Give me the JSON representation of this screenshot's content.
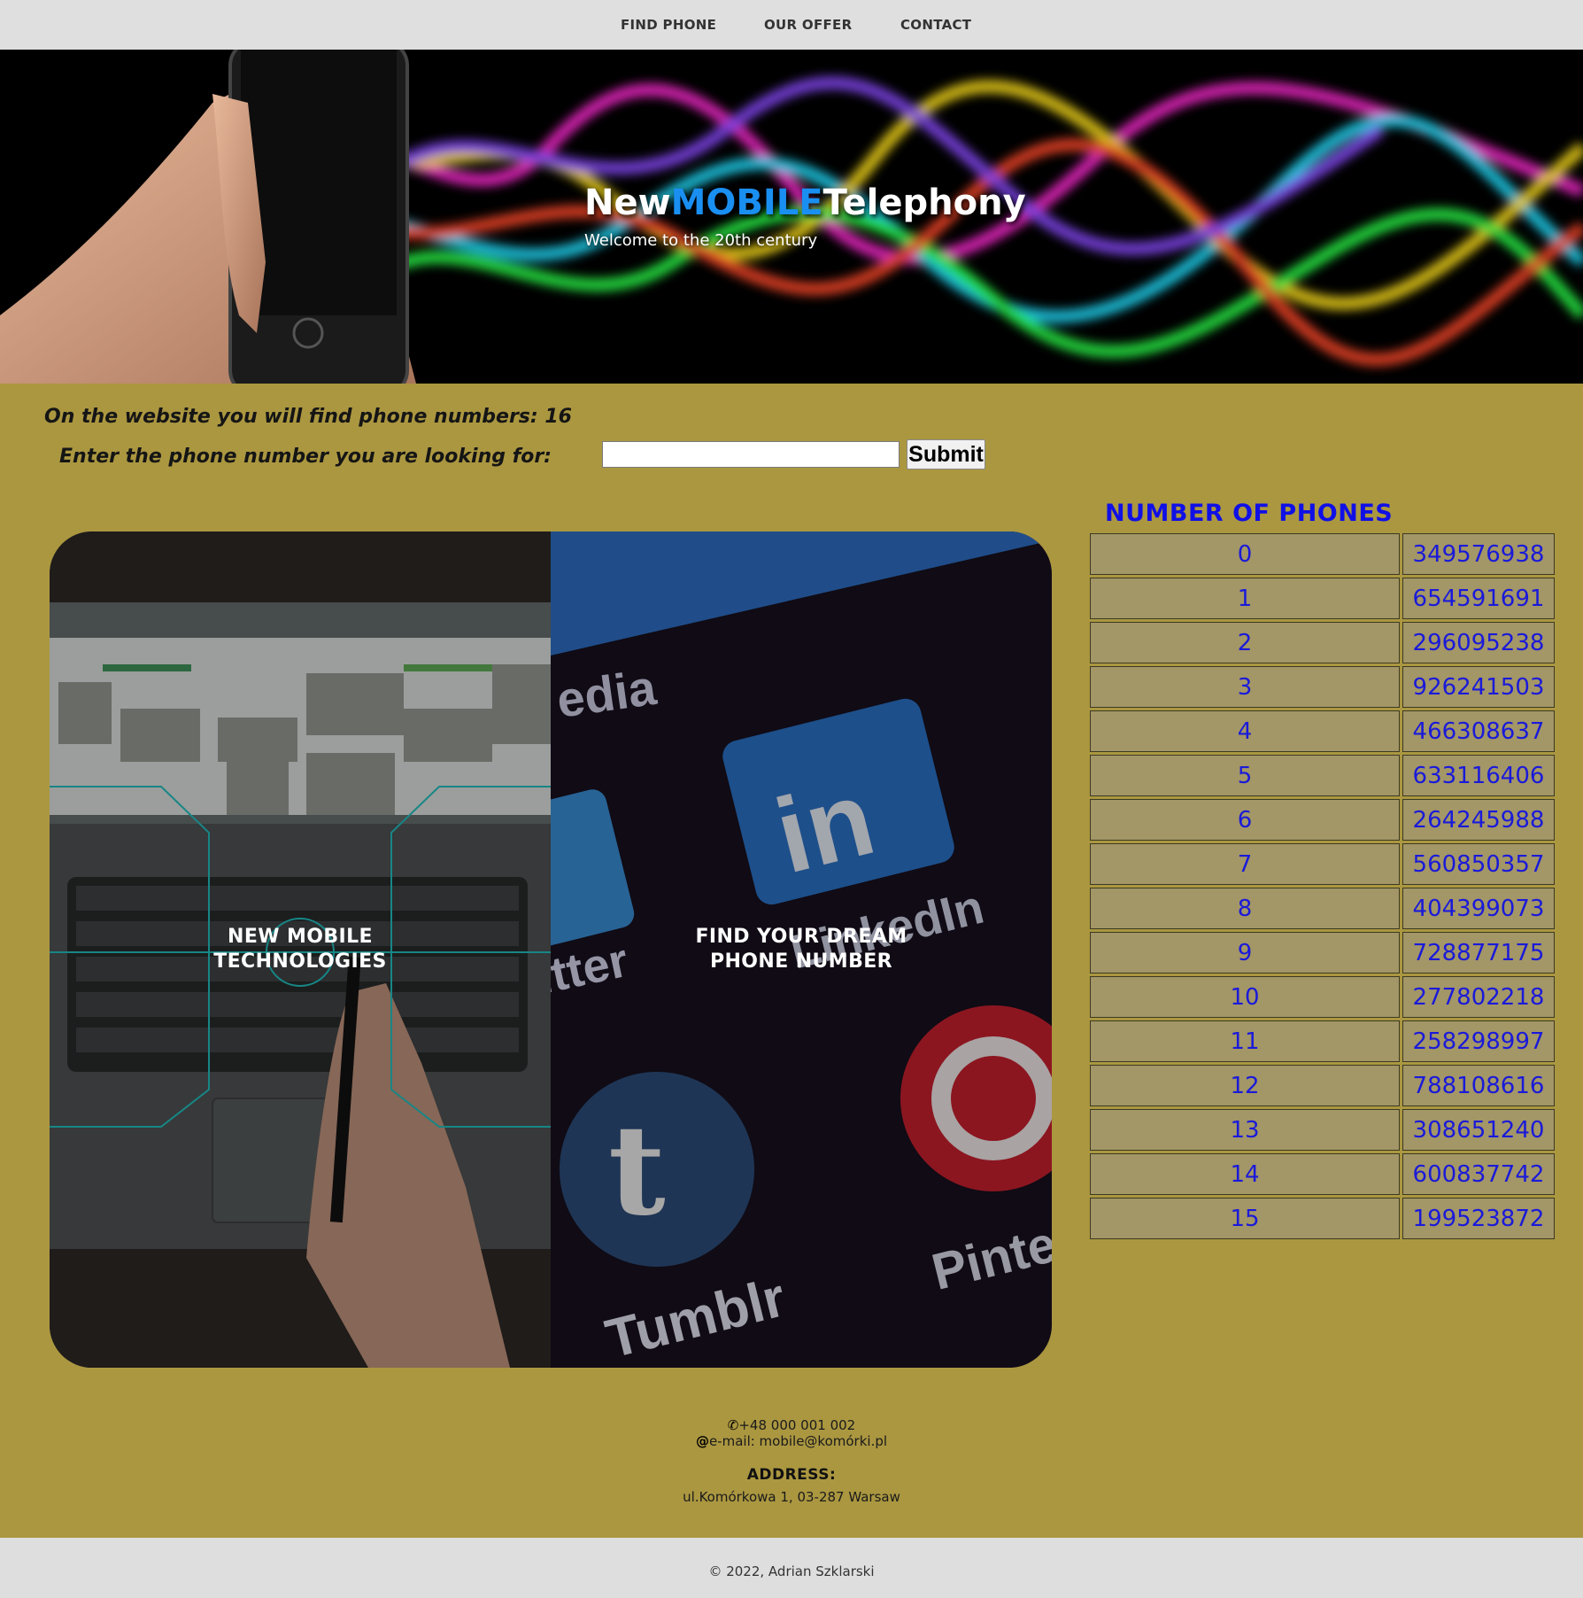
{
  "nav": {
    "items": [
      "FIND PHONE",
      "OUR OFFER",
      "CONTACT"
    ]
  },
  "hero": {
    "title_part1": "New",
    "title_part2": "MOBILE",
    "title_part3": "Telephony",
    "subtitle": "Welcome to the 20th century"
  },
  "info": {
    "count_text": "On the website you will find phone numbers: 16",
    "search_label": "Enter the phone number you are looking for:",
    "search_value": "",
    "submit_label": "Submit"
  },
  "cards": [
    {
      "line1": "NEW MOBILE",
      "line2": "TECHNOLOGIES"
    },
    {
      "line1": "FIND YOUR DREAM",
      "line2": "PHONE NUMBER"
    }
  ],
  "phones": {
    "title": "NUMBER OF PHONES",
    "rows": [
      [
        "0",
        "349576938"
      ],
      [
        "1",
        "654591691"
      ],
      [
        "2",
        "296095238"
      ],
      [
        "3",
        "926241503"
      ],
      [
        "4",
        "466308637"
      ],
      [
        "5",
        "633116406"
      ],
      [
        "6",
        "264245988"
      ],
      [
        "7",
        "560850357"
      ],
      [
        "8",
        "404399073"
      ],
      [
        "9",
        "728877175"
      ],
      [
        "10",
        "277802218"
      ],
      [
        "11",
        "258298997"
      ],
      [
        "12",
        "788108616"
      ],
      [
        "13",
        "308651240"
      ],
      [
        "14",
        "600837742"
      ],
      [
        "15",
        "199523872"
      ]
    ]
  },
  "contact": {
    "phone_icon": "phone-icon",
    "phone": "+48 000 001 002",
    "email_icon": "at-icon",
    "email": "e-mail: mobile@komórki.pl",
    "address_title": "ADDRESS:",
    "address": "ul.Komórkowa 1, 03-287 Warsaw"
  },
  "footer": {
    "copyright": "© 2022, Adrian Szklarski"
  },
  "colors": {
    "background": "#ab9740",
    "accent": "#1a8ff2",
    "table_text": "#1a1ad9",
    "nav_bg": "#dfdfdf"
  }
}
